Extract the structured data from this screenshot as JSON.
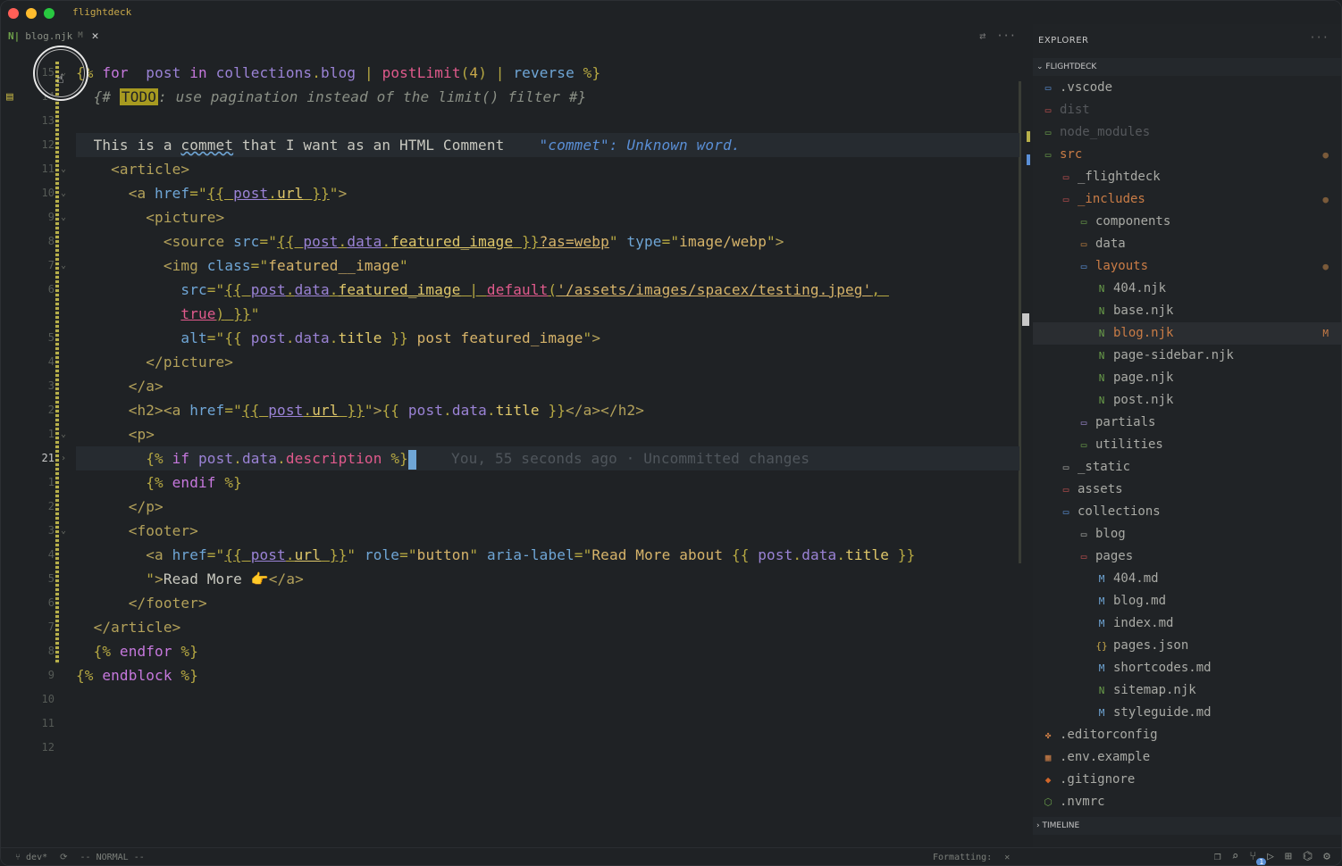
{
  "window": {
    "title": "flightdeck"
  },
  "tab": {
    "icon": "nunjucks-icon",
    "name": "blog.njk",
    "status": "M",
    "close": "✕"
  },
  "editor": {
    "lines": [
      {
        "num": "15",
        "segs": []
      },
      {
        "num": "14",
        "segs": []
      },
      {
        "num": "13",
        "segs": []
      },
      {
        "num": "12",
        "segs": []
      },
      {
        "num": "11",
        "segs": []
      },
      {
        "num": "10",
        "segs": []
      },
      {
        "num": "9",
        "segs": []
      },
      {
        "num": "8",
        "segs": []
      },
      {
        "num": "7",
        "segs": []
      },
      {
        "num": "6",
        "segs": []
      },
      {
        "num": "",
        "segs": []
      },
      {
        "num": "5",
        "segs": []
      },
      {
        "num": "4",
        "segs": []
      },
      {
        "num": "3",
        "segs": []
      },
      {
        "num": "2",
        "segs": []
      },
      {
        "num": "1",
        "segs": []
      },
      {
        "num": "21",
        "segs": []
      },
      {
        "num": "1",
        "segs": []
      },
      {
        "num": "2",
        "segs": []
      },
      {
        "num": "3",
        "segs": []
      },
      {
        "num": "4",
        "segs": []
      },
      {
        "num": "5",
        "segs": []
      },
      {
        "num": "6",
        "segs": []
      },
      {
        "num": "7",
        "segs": []
      },
      {
        "num": "8",
        "segs": []
      },
      {
        "num": "9",
        "segs": []
      },
      {
        "num": "10",
        "segs": []
      },
      {
        "num": "11",
        "segs": []
      },
      {
        "num": "12",
        "segs": []
      }
    ],
    "code": [
      [
        [
          "k-punc",
          "{% "
        ],
        [
          "k-kw",
          "for"
        ],
        [
          "",
          "  "
        ],
        [
          "k-var",
          "post"
        ],
        [
          "",
          " "
        ],
        [
          "k-kw",
          "in"
        ],
        [
          "",
          " "
        ],
        [
          "k-var",
          "collections"
        ],
        [
          "k-punc",
          "."
        ],
        [
          "k-var",
          "blog"
        ],
        [
          "",
          " "
        ],
        [
          "k-punc",
          "|"
        ],
        [
          "",
          " "
        ],
        [
          "k-fn",
          "postLimit"
        ],
        [
          "k-punc",
          "("
        ],
        [
          "k-num",
          "4"
        ],
        [
          "k-punc",
          ")"
        ],
        [
          "",
          " "
        ],
        [
          "k-punc",
          "|"
        ],
        [
          "",
          " "
        ],
        [
          "k-attr",
          "reverse"
        ],
        [
          "",
          " "
        ],
        [
          "k-punc",
          "%}"
        ]
      ],
      [
        [
          "k-com",
          "  {# "
        ],
        [
          "todo",
          "TODO"
        ],
        [
          "k-com",
          ": use pagination instead of the limit() filter #}"
        ]
      ],
      [],
      [
        [
          "",
          " "
        ],
        [
          "",
          " This is a "
        ],
        [
          "squig",
          "commet"
        ],
        [
          "",
          " that I want as an HTML Comment    "
        ],
        [
          "diag",
          "\"commet\": Unknown word."
        ]
      ],
      [
        [
          "k-tag",
          "    <article>"
        ]
      ],
      [
        [
          "k-tag",
          "      <a "
        ],
        [
          "k-attr",
          "href"
        ],
        [
          "k-punc",
          "=\""
        ],
        [
          "k-punc ul",
          "{{ "
        ],
        [
          "k-var ul",
          "post"
        ],
        [
          "k-punc ul",
          "."
        ],
        [
          "k-prop ul",
          "url"
        ],
        [
          "k-punc ul",
          " }}"
        ],
        [
          "k-punc",
          "\""
        ],
        [
          "k-tag",
          ">"
        ]
      ],
      [
        [
          "k-tag",
          "        <picture>"
        ]
      ],
      [
        [
          "k-tag",
          "          <source "
        ],
        [
          "k-attr",
          "src"
        ],
        [
          "k-punc",
          "=\""
        ],
        [
          "k-punc ul",
          "{{ "
        ],
        [
          "k-var ul",
          "post"
        ],
        [
          "k-punc ul",
          "."
        ],
        [
          "k-var ul",
          "data"
        ],
        [
          "k-punc ul",
          "."
        ],
        [
          "k-prop ul",
          "featured_image"
        ],
        [
          "k-punc ul",
          " }}"
        ],
        [
          "k-str ul",
          "?as=webp"
        ],
        [
          "k-punc",
          "\""
        ],
        [
          "",
          " "
        ],
        [
          "k-attr",
          "type"
        ],
        [
          "k-punc",
          "=\""
        ],
        [
          "k-str",
          "image/webp"
        ],
        [
          "k-punc",
          "\""
        ],
        [
          "k-tag",
          ">"
        ]
      ],
      [
        [
          "k-tag",
          "          <img "
        ],
        [
          "k-attr",
          "class"
        ],
        [
          "k-punc",
          "=\""
        ],
        [
          "k-str",
          "featured__image"
        ],
        [
          "k-punc",
          "\""
        ]
      ],
      [
        [
          "",
          "            "
        ],
        [
          "k-attr",
          "src"
        ],
        [
          "k-punc",
          "=\""
        ],
        [
          "k-punc ul",
          "{{ "
        ],
        [
          "k-var ul",
          "post"
        ],
        [
          "k-punc ul",
          "."
        ],
        [
          "k-var ul",
          "data"
        ],
        [
          "k-punc ul",
          "."
        ],
        [
          "k-prop ul",
          "featured_image"
        ],
        [
          "k-punc ul",
          " | "
        ],
        [
          "k-fn ul",
          "default"
        ],
        [
          "k-punc ul",
          "("
        ],
        [
          "k-str ul",
          "'/assets/images/spacex/testing.jpeg'"
        ],
        [
          "k-punc ul",
          ", "
        ]
      ],
      [
        [
          "",
          "            "
        ],
        [
          "k-fn ul",
          "true"
        ],
        [
          "k-punc ul",
          ")"
        ],
        [
          "k-punc ul",
          " }}"
        ],
        [
          "k-punc",
          "\""
        ]
      ],
      [
        [
          "",
          "            "
        ],
        [
          "k-attr",
          "alt"
        ],
        [
          "k-punc",
          "=\""
        ],
        [
          "k-punc",
          "{{ "
        ],
        [
          "k-var",
          "post"
        ],
        [
          "k-punc",
          "."
        ],
        [
          "k-var",
          "data"
        ],
        [
          "k-punc",
          "."
        ],
        [
          "k-prop",
          "title"
        ],
        [
          "k-punc",
          " }}"
        ],
        [
          "k-str",
          " post featured_image"
        ],
        [
          "k-punc",
          "\""
        ],
        [
          "k-tag",
          ">"
        ]
      ],
      [
        [
          "k-tag",
          "        </picture>"
        ]
      ],
      [
        [
          "k-tag",
          "      </a>"
        ]
      ],
      [
        [
          "k-tag",
          "      <h2><a "
        ],
        [
          "k-attr",
          "href"
        ],
        [
          "k-punc",
          "=\""
        ],
        [
          "k-punc ul",
          "{{ "
        ],
        [
          "k-var ul",
          "post"
        ],
        [
          "k-punc ul",
          "."
        ],
        [
          "k-prop ul",
          "url"
        ],
        [
          "k-punc ul",
          " }}"
        ],
        [
          "k-punc",
          "\""
        ],
        [
          "k-tag",
          ">"
        ],
        [
          "k-punc",
          "{{ "
        ],
        [
          "k-var",
          "post"
        ],
        [
          "k-punc",
          "."
        ],
        [
          "k-var",
          "data"
        ],
        [
          "k-punc",
          "."
        ],
        [
          "k-prop",
          "title"
        ],
        [
          "k-punc",
          " }}"
        ],
        [
          "k-tag",
          "</a></h2>"
        ]
      ],
      [
        [
          "k-tag",
          "      <p>"
        ]
      ],
      [
        [
          "",
          "        "
        ],
        [
          "k-punc",
          "{%"
        ],
        [
          "",
          " "
        ],
        [
          "k-kw",
          "if"
        ],
        [
          "",
          " "
        ],
        [
          "k-var",
          "post"
        ],
        [
          "k-punc",
          "."
        ],
        [
          "k-var",
          "data"
        ],
        [
          "k-punc",
          "."
        ],
        [
          "k-fn",
          "description"
        ],
        [
          "",
          " "
        ],
        [
          "k-punc",
          "%}"
        ],
        [
          "cursor",
          ""
        ],
        [
          "",
          "    "
        ],
        [
          "blame",
          "You, 55 seconds ago · Uncommitted changes"
        ],
        [
          "",
          ""
        ]
      ],
      [
        [
          "",
          "        "
        ],
        [
          "k-punc",
          "{% "
        ],
        [
          "k-kw",
          "endif"
        ],
        [
          "k-punc",
          " %}"
        ]
      ],
      [
        [
          "k-tag",
          "      </p>"
        ]
      ],
      [
        [
          "k-tag",
          "      <footer>"
        ]
      ],
      [
        [
          "k-tag",
          "        <a "
        ],
        [
          "k-attr",
          "href"
        ],
        [
          "k-punc",
          "=\""
        ],
        [
          "k-punc ul",
          "{{ "
        ],
        [
          "k-var ul",
          "post"
        ],
        [
          "k-punc ul",
          "."
        ],
        [
          "k-prop ul",
          "url"
        ],
        [
          "k-punc ul",
          " }}"
        ],
        [
          "k-punc",
          "\""
        ],
        [
          "",
          " "
        ],
        [
          "k-attr",
          "role"
        ],
        [
          "k-punc",
          "=\""
        ],
        [
          "k-str",
          "button"
        ],
        [
          "k-punc",
          "\""
        ],
        [
          "",
          " "
        ],
        [
          "k-attr",
          "aria-label"
        ],
        [
          "k-punc",
          "=\""
        ],
        [
          "k-str",
          "Read More about "
        ],
        [
          "k-punc",
          "{{ "
        ],
        [
          "k-var",
          "post"
        ],
        [
          "k-punc",
          "."
        ],
        [
          "k-var",
          "data"
        ],
        [
          "k-punc",
          "."
        ],
        [
          "k-prop",
          "title"
        ],
        [
          "k-punc",
          " }}"
        ]
      ],
      [
        [
          "",
          "        "
        ],
        [
          "k-punc",
          "\""
        ],
        [
          "k-tag",
          ">"
        ],
        [
          "",
          "Read More "
        ],
        [
          "k-num",
          "👉"
        ],
        [
          "k-tag",
          "</a>"
        ]
      ],
      [
        [
          "k-tag",
          "      </footer>"
        ]
      ],
      [
        [
          "k-tag",
          "  </article>"
        ]
      ],
      [
        [
          "k-punc",
          "  {% "
        ],
        [
          "k-kw",
          "endfor"
        ],
        [
          "k-punc",
          " %}"
        ]
      ],
      [
        [
          "k-punc",
          "{% "
        ],
        [
          "k-kw",
          "endblock"
        ],
        [
          "k-punc",
          " %}"
        ]
      ],
      []
    ]
  },
  "explorer": {
    "title": "EXPLORER",
    "section": "FLIGHTDECK",
    "timeline": "TIMELINE",
    "items": [
      {
        "label": ".vscode",
        "icon": "vscode-folder-icon",
        "glyph": "▭",
        "indent": 0,
        "cls": "c-norm",
        "ic": "#5a8fd6"
      },
      {
        "label": "dist",
        "icon": "folder-dist-icon",
        "glyph": "▭",
        "indent": 0,
        "cls": "c-dim",
        "ic": "#c05050"
      },
      {
        "label": "node_modules",
        "icon": "folder-node-icon",
        "glyph": "▭",
        "indent": 0,
        "cls": "c-dim",
        "ic": "#6a9e4a"
      },
      {
        "label": "src",
        "icon": "folder-src-icon",
        "glyph": "▭",
        "indent": 0,
        "cls": "c-mod",
        "ic": "#6a9e4a",
        "badge": "●",
        "bc": "#7a5a3a"
      },
      {
        "label": "_flightdeck",
        "icon": "folder-icon",
        "glyph": "▭",
        "indent": 1,
        "cls": "c-norm",
        "ic": "#c05050"
      },
      {
        "label": "_includes",
        "icon": "folder-includes-icon",
        "glyph": "▭",
        "indent": 1,
        "cls": "c-mod",
        "ic": "#c05050",
        "badge": "●",
        "bc": "#7a5a3a"
      },
      {
        "label": "components",
        "icon": "folder-components-icon",
        "glyph": "▭",
        "indent": 2,
        "cls": "c-norm",
        "ic": "#6a9e4a"
      },
      {
        "label": "data",
        "icon": "folder-data-icon",
        "glyph": "▭",
        "indent": 2,
        "cls": "c-norm",
        "ic": "#c08040"
      },
      {
        "label": "layouts",
        "icon": "folder-layouts-icon",
        "glyph": "▭",
        "indent": 2,
        "cls": "c-mod",
        "ic": "#5a8fd6",
        "badge": "●",
        "bc": "#7a5a3a"
      },
      {
        "label": "404.njk",
        "icon": "nunjucks-icon",
        "glyph": "N",
        "indent": 3,
        "cls": "c-norm",
        "ic": "#6a9e4a"
      },
      {
        "label": "base.njk",
        "icon": "nunjucks-icon",
        "glyph": "N",
        "indent": 3,
        "cls": "c-norm",
        "ic": "#6a9e4a"
      },
      {
        "label": "blog.njk",
        "icon": "nunjucks-icon",
        "glyph": "N",
        "indent": 3,
        "cls": "c-mod",
        "ic": "#6a9e4a",
        "badge": "M",
        "bc": "#c97c46",
        "sel": true
      },
      {
        "label": "page-sidebar.njk",
        "icon": "nunjucks-icon",
        "glyph": "N",
        "indent": 3,
        "cls": "c-norm",
        "ic": "#6a9e4a"
      },
      {
        "label": "page.njk",
        "icon": "nunjucks-icon",
        "glyph": "N",
        "indent": 3,
        "cls": "c-norm",
        "ic": "#6a9e4a"
      },
      {
        "label": "post.njk",
        "icon": "nunjucks-icon",
        "glyph": "N",
        "indent": 3,
        "cls": "c-norm",
        "ic": "#6a9e4a"
      },
      {
        "label": "partials",
        "icon": "folder-partials-icon",
        "glyph": "▭",
        "indent": 2,
        "cls": "c-norm",
        "ic": "#9d89d0"
      },
      {
        "label": "utilities",
        "icon": "folder-utilities-icon",
        "glyph": "▭",
        "indent": 2,
        "cls": "c-norm",
        "ic": "#6a9e4a"
      },
      {
        "label": "_static",
        "icon": "folder-static-icon",
        "glyph": "▭",
        "indent": 1,
        "cls": "c-norm",
        "ic": "#a9aaa5"
      },
      {
        "label": "assets",
        "icon": "folder-assets-icon",
        "glyph": "▭",
        "indent": 1,
        "cls": "c-norm",
        "ic": "#c05050"
      },
      {
        "label": "collections",
        "icon": "folder-collections-icon",
        "glyph": "▭",
        "indent": 1,
        "cls": "c-norm",
        "ic": "#5a8fd6"
      },
      {
        "label": "blog",
        "icon": "folder-icon",
        "glyph": "▭",
        "indent": 2,
        "cls": "c-norm",
        "ic": "#a9aaa5"
      },
      {
        "label": "pages",
        "icon": "folder-pages-icon",
        "glyph": "▭",
        "indent": 2,
        "cls": "c-norm",
        "ic": "#c05050"
      },
      {
        "label": "404.md",
        "icon": "markdown-icon",
        "glyph": "M",
        "indent": 3,
        "cls": "c-norm",
        "ic": "#6fa6d6"
      },
      {
        "label": "blog.md",
        "icon": "markdown-icon",
        "glyph": "M",
        "indent": 3,
        "cls": "c-norm",
        "ic": "#6fa6d6"
      },
      {
        "label": "index.md",
        "icon": "markdown-icon",
        "glyph": "M",
        "indent": 3,
        "cls": "c-norm",
        "ic": "#6fa6d6"
      },
      {
        "label": "pages.json",
        "icon": "json-icon",
        "glyph": "{}",
        "indent": 3,
        "cls": "c-norm",
        "ic": "#c8a84a"
      },
      {
        "label": "shortcodes.md",
        "icon": "markdown-icon",
        "glyph": "M",
        "indent": 3,
        "cls": "c-norm",
        "ic": "#6fa6d6"
      },
      {
        "label": "sitemap.njk",
        "icon": "nunjucks-icon",
        "glyph": "N",
        "indent": 3,
        "cls": "c-norm",
        "ic": "#6a9e4a"
      },
      {
        "label": "styleguide.md",
        "icon": "markdown-icon",
        "glyph": "M",
        "indent": 3,
        "cls": "c-norm",
        "ic": "#6fa6d6"
      },
      {
        "label": ".editorconfig",
        "icon": "editorconfig-icon",
        "glyph": "✤",
        "indent": 0,
        "cls": "c-norm",
        "ic": "#c97c46"
      },
      {
        "label": ".env.example",
        "icon": "env-icon",
        "glyph": "▦",
        "indent": 0,
        "cls": "c-norm",
        "ic": "#c97c46"
      },
      {
        "label": ".gitignore",
        "icon": "git-icon",
        "glyph": "◆",
        "indent": 0,
        "cls": "c-norm",
        "ic": "#d0662a"
      },
      {
        "label": ".nvmrc",
        "icon": "node-icon",
        "glyph": "⬡",
        "indent": 0,
        "cls": "c-norm",
        "ic": "#6a9e4a"
      }
    ]
  },
  "statusbar": {
    "branch": "dev*",
    "mode": "-- NORMAL --",
    "formatting": "Formatting:",
    "formatting_state": "✕",
    "badge_count": "1"
  }
}
